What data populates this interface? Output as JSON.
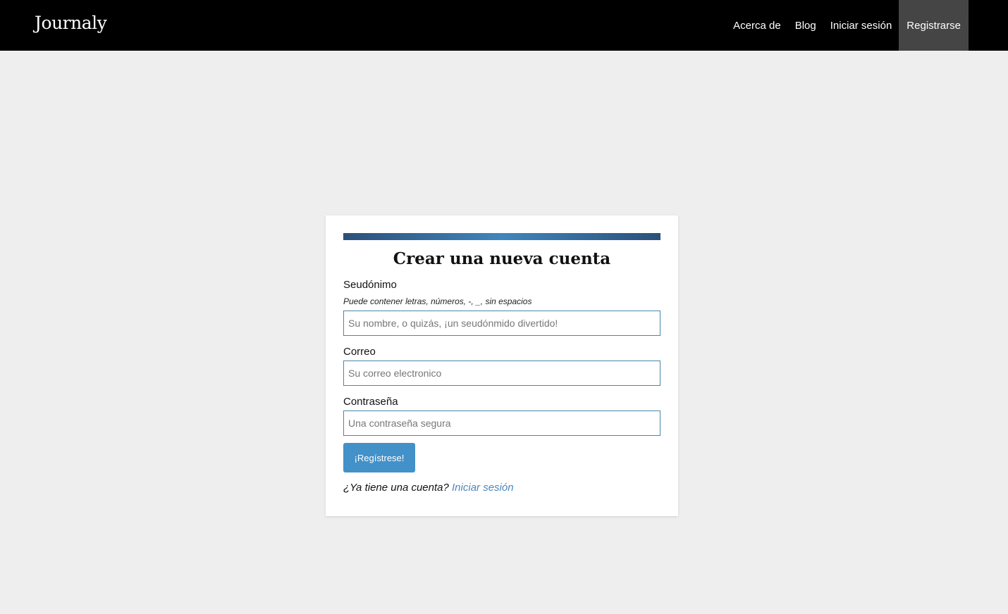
{
  "header": {
    "brand": "Journaly",
    "nav": [
      {
        "label": "Acerca de"
      },
      {
        "label": "Blog"
      },
      {
        "label": "Iniciar sesión"
      },
      {
        "label": "Registrarse"
      }
    ]
  },
  "form": {
    "title": "Crear una nueva cuenta",
    "username": {
      "label": "Seudónimo",
      "hint": "Puede contener letras, números, -, _, sin espacios",
      "placeholder": "Su nombre, o quizás, ¡un seudónmido divertido!",
      "value": ""
    },
    "email": {
      "label": "Correo",
      "placeholder": "Su correo electronico",
      "value": ""
    },
    "password": {
      "label": "Contraseña",
      "placeholder": "Una contraseña segura",
      "value": ""
    },
    "submit_label": "¡Regístrese!",
    "login_prompt": "¿Ya tiene una cuenta?",
    "login_link": "Iniciar sesión"
  },
  "colors": {
    "header_bg": "#000000",
    "active_nav_bg": "#454545",
    "page_bg": "#eeeeee",
    "accent_dark": "#2c4f7a",
    "accent_light": "#3f86bd",
    "button_bg": "#4391c9",
    "link": "#4a86bd"
  }
}
